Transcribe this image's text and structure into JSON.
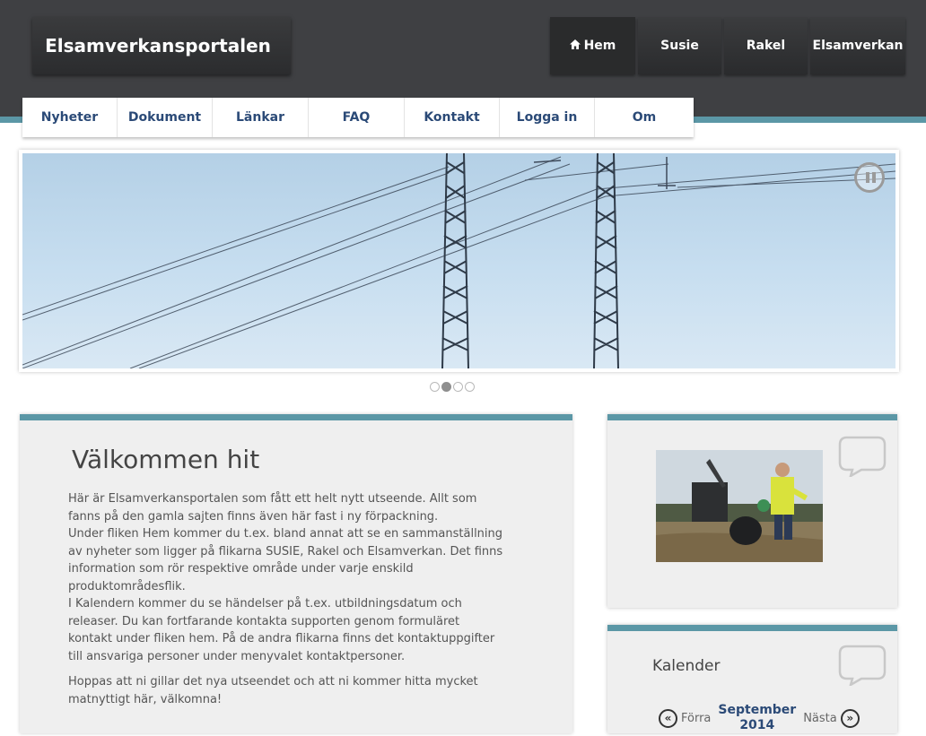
{
  "header": {
    "site_title": "Elsamverkansportalen",
    "top_tabs": [
      {
        "label": "Hem",
        "icon": "home-icon",
        "active": true
      },
      {
        "label": "Susie"
      },
      {
        "label": "Rakel"
      },
      {
        "label": "Elsamverkan"
      }
    ]
  },
  "subnav": {
    "items": [
      "Nyheter",
      "Dokument",
      "Länkar",
      "FAQ",
      "Kontakt",
      "Logga in",
      "Om"
    ]
  },
  "slider": {
    "control_icon": "pause-icon",
    "dot_count": 4,
    "active_dot": 1
  },
  "main": {
    "title": "Välkommen hit",
    "paragraphs": [
      "Här är Elsamverkansportalen som fått ett helt nytt utseende. Allt som\nfanns på den gamla sajten finns även här fast i ny förpackning.\nUnder fliken Hem kommer du t.ex. bland annat att se en sammanställning\nav nyheter som ligger på flikarna SUSIE, Rakel och Elsamverkan. Det finns\ninformation som rör respektive område under varje enskild\nproduktområdesflik.\n I Kalendern kommer du se händelser på t.ex. utbildningsdatum och\nreleaser. Du kan fortfarande kontakta supporten genom formuläret\nkontakt under fliken hem. På de andra flikarna finns det kontaktuppgifter\ntill ansvariga personer under menyvalet kontaktpersoner.",
      "Hoppas att ni gillar det nya utseendet och att ni kommer hitta mycket\nmatnyttigt här, välkomna!"
    ]
  },
  "calendar": {
    "title": "Kalender",
    "prev_label": "Förra",
    "next_label": "Nästa",
    "month": "September",
    "year": "2014"
  },
  "colors": {
    "header_bg": "#3f4043",
    "accent": "#5b97a6",
    "link": "#2b4a77",
    "panel_bg": "#efefef"
  }
}
